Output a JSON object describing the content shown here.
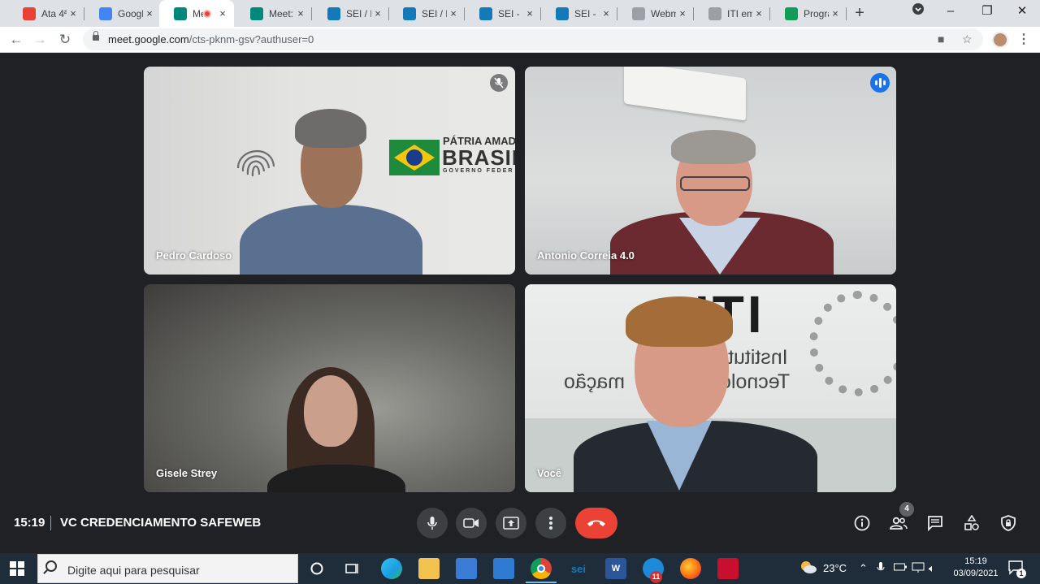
{
  "browser": {
    "tabs": [
      {
        "title": "Ata 4ª",
        "favicon": "chrome-icon",
        "color": "#e94235"
      },
      {
        "title": "Google",
        "favicon": "google-calendar-icon",
        "color": "#4285f4"
      },
      {
        "title": "Me",
        "favicon": "google-meet-icon",
        "color": "#00897b",
        "active": true
      },
      {
        "title": "Meet: ",
        "favicon": "google-meet-icon",
        "color": "#00897b"
      },
      {
        "title": "SEI / M",
        "favicon": "sei-icon",
        "color": "#1479b8"
      },
      {
        "title": "SEI / M",
        "favicon": "sei-icon",
        "color": "#1479b8"
      },
      {
        "title": "SEI - D",
        "favicon": "sei-icon",
        "color": "#1479b8"
      },
      {
        "title": "SEI - P",
        "favicon": "sei-icon",
        "color": "#1479b8"
      },
      {
        "title": "Webm",
        "favicon": "globe-icon",
        "color": "#9aa0a6"
      },
      {
        "title": "ITI em",
        "favicon": "globe-icon",
        "color": "#9aa0a6"
      },
      {
        "title": "Progra",
        "favicon": "google-sheets-icon",
        "color": "#0f9d58"
      }
    ],
    "tab_close": "×",
    "new_tab": "+",
    "url_host": "meet.google.com",
    "url_path": "/cts-pknm-gsv?authuser=0"
  },
  "tiles": [
    {
      "name": "Pedro Cardoso",
      "muted": true
    },
    {
      "name": "Antonio Correia 4.0",
      "speaking": true
    },
    {
      "name": "Gisele Strey"
    },
    {
      "name": "Você"
    }
  ],
  "backdrop": {
    "brand_line1": "PÁTRIA AMAD",
    "brand_line2": "BRASIL",
    "brand_line3": "GOVERNO FEDER",
    "iti_logo": "ITI",
    "iti_line1": "Institut",
    "iti_line2": "Tecnolo",
    "iti_line3": "mação"
  },
  "meeting": {
    "time": "15:19",
    "title": "VC CREDENCIAMENTO SAFEWEB",
    "participants_count": "4"
  },
  "taskbar": {
    "search_placeholder": "Digite aqui para pesquisar",
    "temperature": "23°C",
    "time": "15:19",
    "date": "03/09/2021",
    "notification_count": "1",
    "mail_badge": "11"
  },
  "colors": {
    "meet_bg": "#202124",
    "speaking_outline": "#8ab4f8",
    "hangup": "#ea4335",
    "taskbar": "#1f2d3a"
  }
}
